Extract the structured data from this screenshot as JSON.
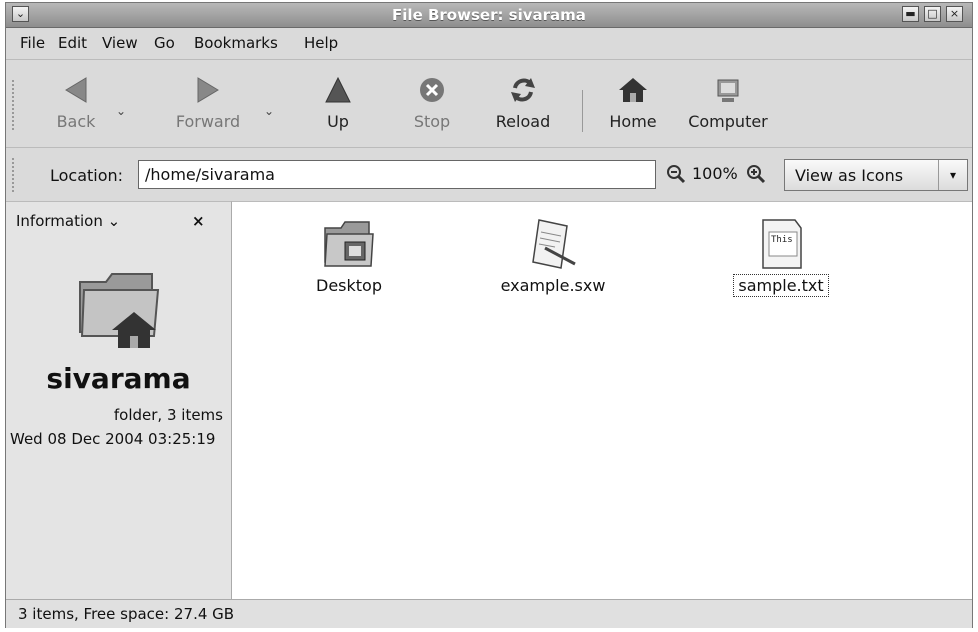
{
  "window": {
    "title": "File Browser: sivarama"
  },
  "menu": {
    "items": [
      "File",
      "Edit",
      "View",
      "Go",
      "Bookmarks",
      "Help"
    ]
  },
  "toolbar": {
    "back": "Back",
    "forward": "Forward",
    "up": "Up",
    "stop": "Stop",
    "reload": "Reload",
    "home": "Home",
    "computer": "Computer"
  },
  "location": {
    "label": "Location:",
    "path": "/home/sivarama",
    "zoom": "100%",
    "view_mode": "View as Icons"
  },
  "sidepane": {
    "header": "Information",
    "folder_name": "sivarama",
    "folder_info": "folder, 3 items",
    "modified": "Wed 08 Dec 2004 03:25:19"
  },
  "files": [
    {
      "name": "Desktop",
      "icon": "folder-icon"
    },
    {
      "name": "example.sxw",
      "icon": "document-icon"
    },
    {
      "name": "sample.txt",
      "icon": "text-file-icon",
      "icon_text": "This",
      "selected": true
    }
  ],
  "status": {
    "text": "3 items, Free space: 27.4 GB"
  }
}
